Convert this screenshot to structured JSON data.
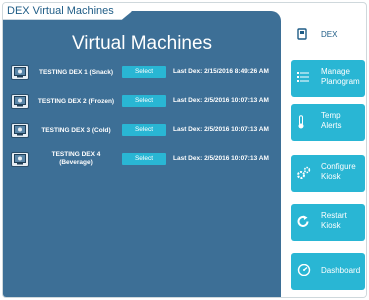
{
  "breadcrumb": "DEX Virtual Machines",
  "title": "Virtual Machines",
  "machines": [
    {
      "name_line1": "TESTING DEX 1 (Snack)",
      "name_line2": "",
      "select_label": "Select",
      "last_dex": "Last Dex: 2/15/2016 8:49:26 AM"
    },
    {
      "name_line1": "TESTING DEX 2 (Frozen)",
      "name_line2": "",
      "select_label": "Select",
      "last_dex": "Last Dex: 2/5/2016 10:07:13 AM"
    },
    {
      "name_line1": "TESTING DEX 3 (Cold)",
      "name_line2": "",
      "select_label": "Select",
      "last_dex": "Last Dex: 2/5/2016 10:07:13 AM"
    },
    {
      "name_line1": "TESTING DEX 4",
      "name_line2": "(Beverage)",
      "select_label": "Select",
      "last_dex": "Last Dex: 2/5/2016 10:07:13 AM"
    }
  ],
  "sidebar": {
    "dex": {
      "label": "DEX",
      "icon": "dex-icon"
    },
    "manage_planogram": {
      "line1": "Manage",
      "line2": "Planogram",
      "icon": "list-icon"
    },
    "temp_alerts": {
      "line1": "Temp",
      "line2": "Alerts",
      "icon": "thermometer-icon"
    },
    "configure_kiosk": {
      "line1": "Configure",
      "line2": "Kiosk",
      "icon": "gears-icon"
    },
    "restart_kiosk": {
      "line1": "Restart",
      "line2": "Kiosk",
      "icon": "restart-icon"
    },
    "dashboard": {
      "label": "Dashboard",
      "icon": "gauge-icon"
    }
  },
  "colors": {
    "main_panel": "#3d6f96",
    "accent": "#29b6d4",
    "breadcrumb_text": "#1e5c86"
  }
}
